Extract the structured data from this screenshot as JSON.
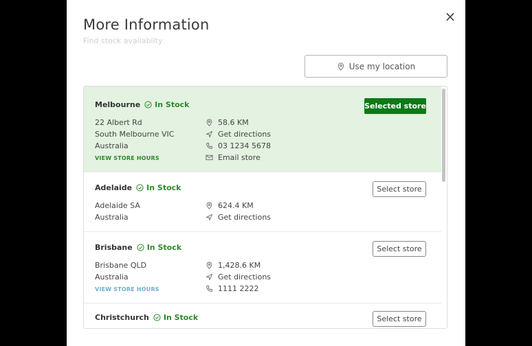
{
  "modal": {
    "title": "More Information",
    "subtitle": "Find stock availablity",
    "close_label": "×",
    "location_button": "Use my location"
  },
  "stores": [
    {
      "name": "Melbourne",
      "stock": "In Stock",
      "address": [
        "22 Albert Rd",
        "South Melbourne VIC",
        "Australia"
      ],
      "hours_link": "VIEW STORE HOURS",
      "distance": "58.6 KM",
      "directions": "Get directions",
      "phone": "03 1234 5678",
      "email": "Email store",
      "button": "Selected store",
      "selected": true
    },
    {
      "name": "Adelaide",
      "stock": "In Stock",
      "address": [
        "Adelaide SA",
        "Australia"
      ],
      "distance": "624.4 KM",
      "directions": "Get directions",
      "button": "Select store",
      "selected": false
    },
    {
      "name": "Brisbane",
      "stock": "In Stock",
      "address": [
        "Brisbane QLD",
        "Australia"
      ],
      "hours_link": "VIEW STORE HOURS",
      "distance": "1,428.6 KM",
      "directions": "Get directions",
      "phone": "1111 2222",
      "button": "Select store",
      "selected": false
    },
    {
      "name": "Christchurch",
      "stock": "In Stock",
      "button": "Select store",
      "selected": false
    }
  ],
  "colors": {
    "selected_bg": "#e3f2e1",
    "accent_green": "#0c7a17",
    "stock_green": "#2a8a2a",
    "link_blue": "#6aaed6"
  }
}
